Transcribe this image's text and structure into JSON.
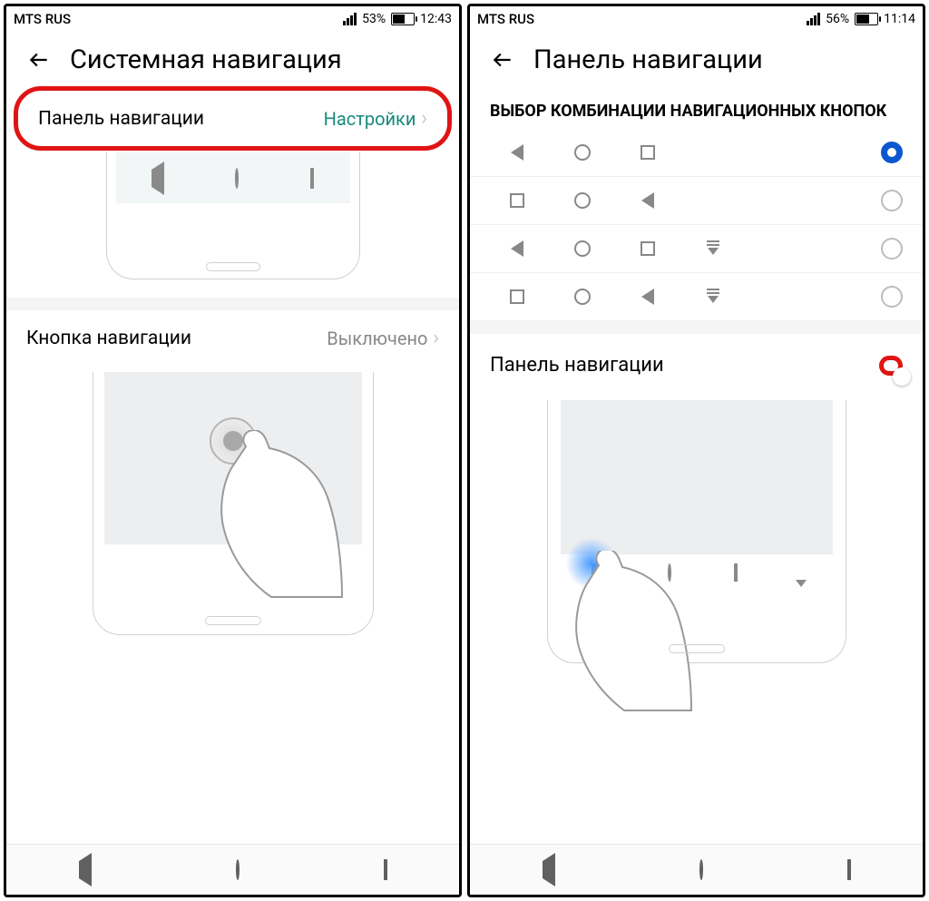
{
  "left": {
    "status": {
      "carrier": "MTS RUS",
      "battery_pct": "53%",
      "time": "12:43",
      "battery_fill_pct": 53
    },
    "header_title": "Системная навигация",
    "row1": {
      "label": "Панель навигации",
      "value": "Настройки"
    },
    "row2": {
      "label": "Кнопка навигации",
      "value": "Выключено"
    }
  },
  "right": {
    "status": {
      "carrier": "MTS RUS",
      "battery_pct": "56%",
      "time": "11:14",
      "battery_fill_pct": 56
    },
    "header_title": "Панель навигации",
    "section_header": "ВЫБОР КОМБИНАЦИИ НАВИГАЦИОННЫХ КНОПОК",
    "toggle_label": "Панель навигации",
    "combos": [
      {
        "icons": [
          "back",
          "home",
          "recent"
        ],
        "selected": true
      },
      {
        "icons": [
          "recent",
          "home",
          "back"
        ],
        "selected": false
      },
      {
        "icons": [
          "back",
          "home",
          "recent",
          "drawer"
        ],
        "selected": false
      },
      {
        "icons": [
          "recent",
          "home",
          "back",
          "drawer"
        ],
        "selected": false
      }
    ]
  }
}
